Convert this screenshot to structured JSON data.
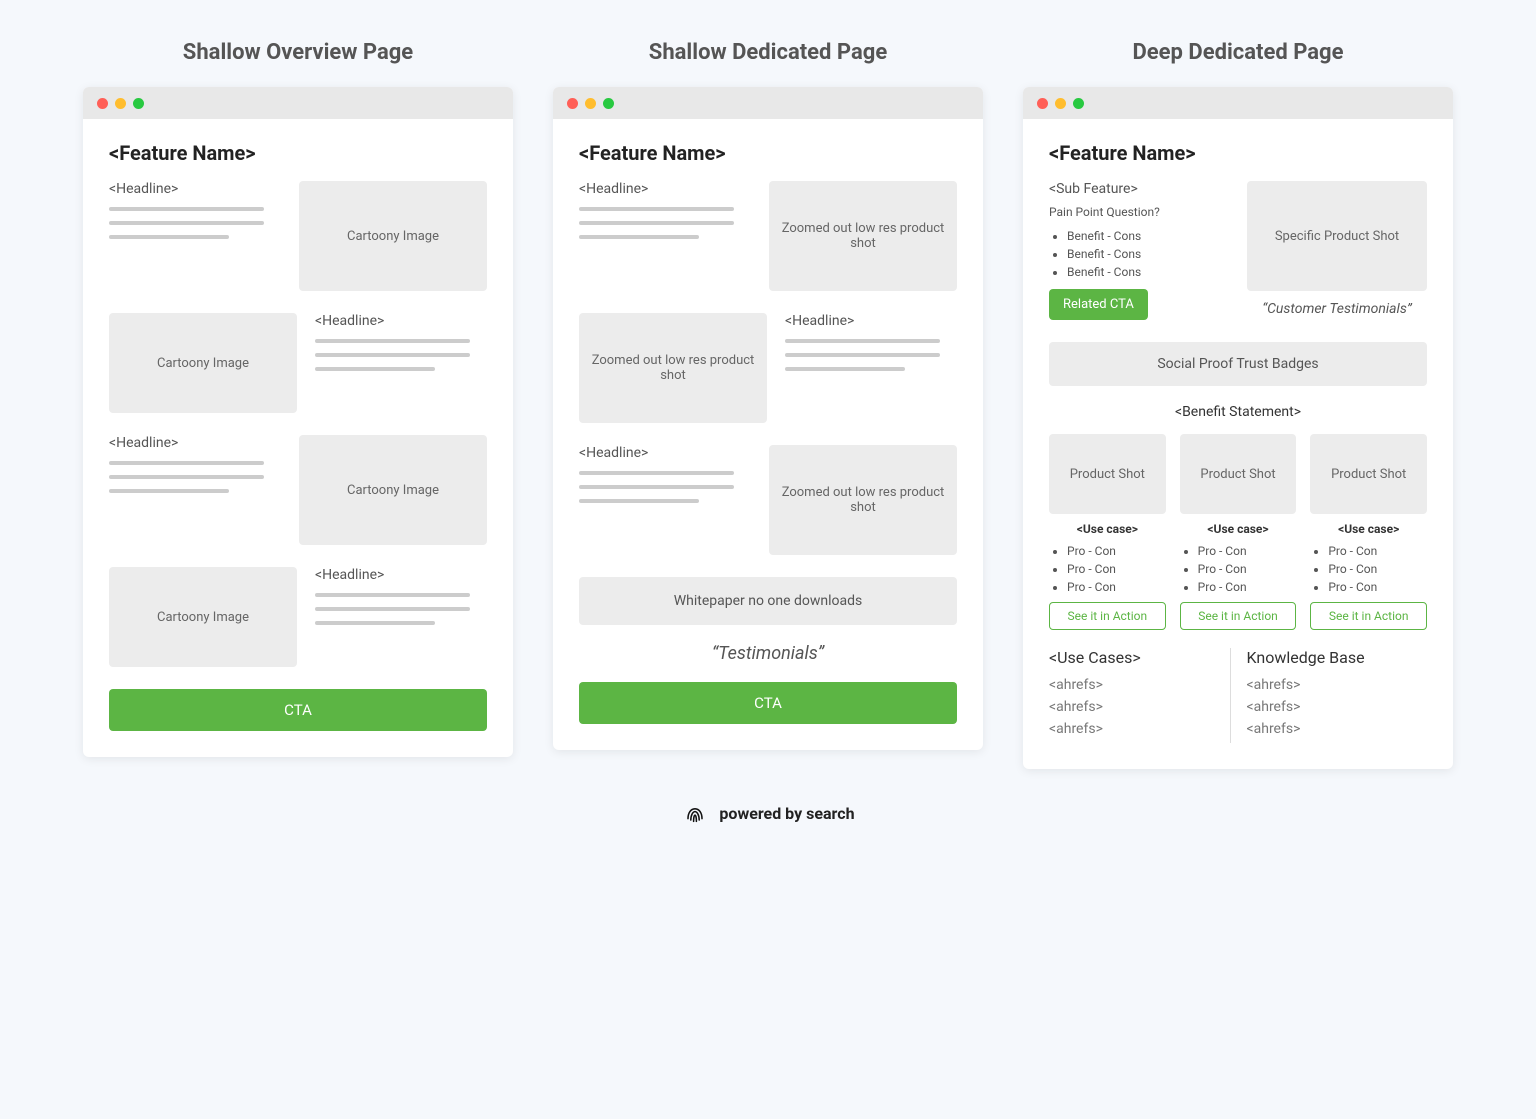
{
  "footer": "powered by search",
  "cols": {
    "shallow_overview": {
      "title": "Shallow Overview Page",
      "feature": "<Feature Name>",
      "rows": [
        {
          "headline": "<Headline>",
          "image": "Cartoony Image",
          "imageFirst": false
        },
        {
          "headline": "<Headline>",
          "image": "Cartoony Image",
          "imageFirst": true
        },
        {
          "headline": "<Headline>",
          "image": "Cartoony Image",
          "imageFirst": false
        },
        {
          "headline": "<Headline>",
          "image": "Cartoony Image",
          "imageFirst": true
        }
      ],
      "cta": "CTA"
    },
    "shallow_dedicated": {
      "title": "Shallow Dedicated Page",
      "feature": "<Feature Name>",
      "rows": [
        {
          "headline": "<Headline>",
          "image": "Zoomed out low res product shot",
          "imageFirst": false
        },
        {
          "headline": "<Headline>",
          "image": "Zoomed out low res product shot",
          "imageFirst": true
        },
        {
          "headline": "<Headline>",
          "image": "Zoomed out low res product shot",
          "imageFirst": false
        }
      ],
      "whitepaper": "Whitepaper no one downloads",
      "testimonials": "“Testimonials”",
      "cta": "CTA"
    },
    "deep_dedicated": {
      "title": "Deep Dedicated Page",
      "feature": "<Feature Name>",
      "sub_feature": "<Sub Feature>",
      "pain": "Pain Point Question?",
      "benefits": [
        "Benefit - Cons",
        "Benefit - Cons",
        "Benefit - Cons"
      ],
      "related_cta": "Related CTA",
      "hero_image": "Specific Product Shot",
      "customer_testimonials": "“Customer Testimonials”",
      "badges": "Social Proof Trust Badges",
      "benefit_statement": "<Benefit Statement>",
      "cards": [
        {
          "image": "Product Shot",
          "usecase": "<Use case>",
          "pros": [
            "Pro - Con",
            "Pro - Con",
            "Pro - Con"
          ],
          "btn": "See it in Action"
        },
        {
          "image": "Product Shot",
          "usecase": "<Use case>",
          "pros": [
            "Pro - Con",
            "Pro - Con",
            "Pro - Con"
          ],
          "btn": "See it in Action"
        },
        {
          "image": "Product Shot",
          "usecase": "<Use case>",
          "pros": [
            "Pro - Con",
            "Pro - Con",
            "Pro - Con"
          ],
          "btn": "See it in Action"
        }
      ],
      "bottom": {
        "use_cases": {
          "title": "<Use Cases>",
          "links": [
            "<ahrefs>",
            "<ahrefs>",
            "<ahrefs>"
          ]
        },
        "kb": {
          "title": "Knowledge Base",
          "links": [
            "<ahrefs>",
            "<ahrefs>",
            "<ahrefs>"
          ]
        }
      }
    }
  }
}
